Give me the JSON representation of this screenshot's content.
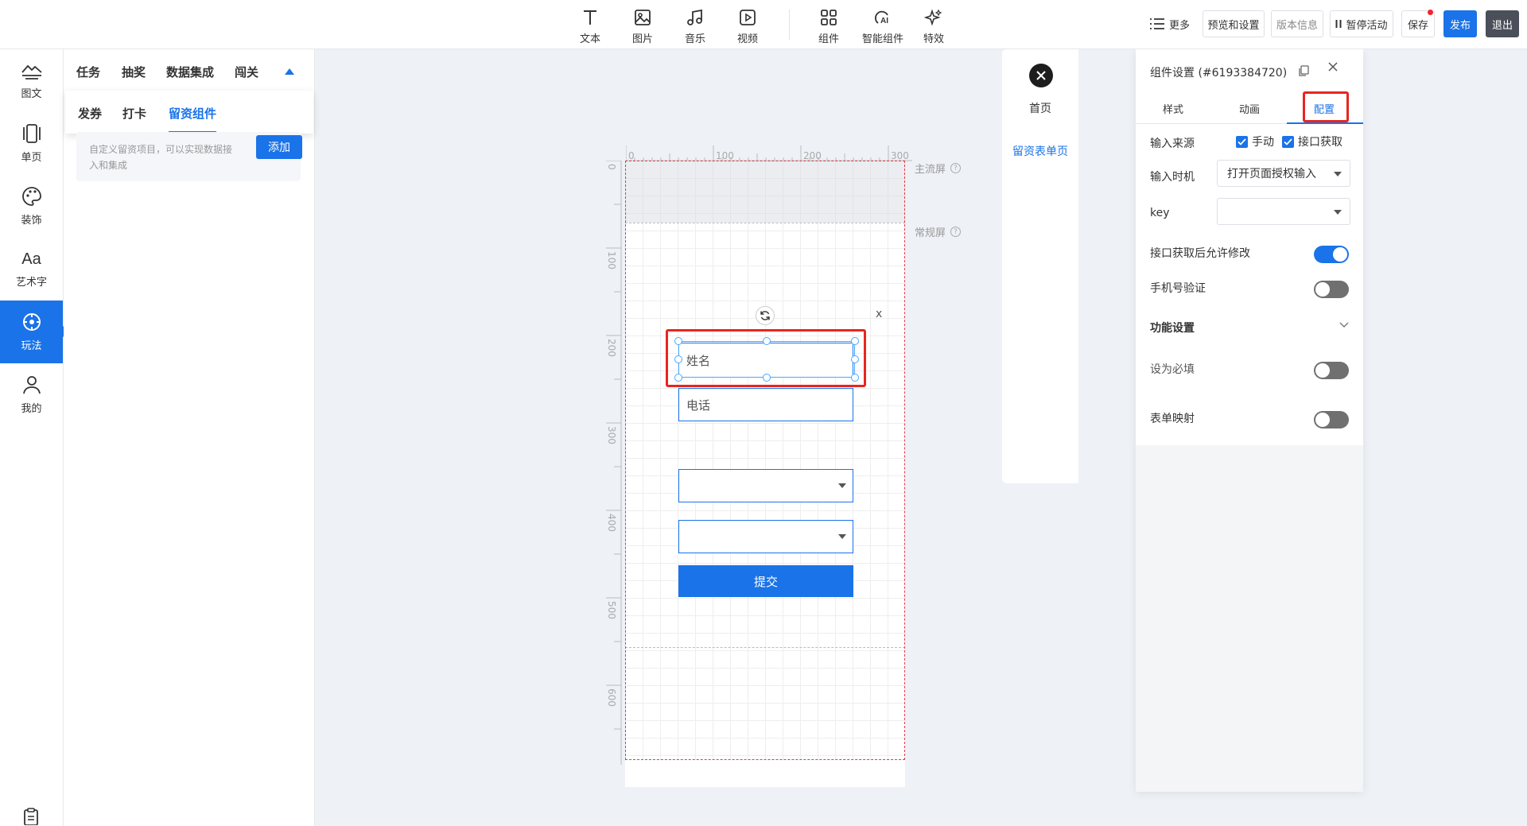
{
  "toolbar": {
    "tools": [
      {
        "label": "文本",
        "icon": "text-icon"
      },
      {
        "label": "图片",
        "icon": "image-icon"
      },
      {
        "label": "音乐",
        "icon": "music-icon"
      },
      {
        "label": "视频",
        "icon": "video-icon"
      },
      {
        "label": "组件",
        "icon": "components-icon"
      },
      {
        "label": "智能组件",
        "icon": "ai-icon"
      },
      {
        "label": "特效",
        "icon": "sparkle-icon"
      }
    ],
    "more_label": "更多",
    "preview_label": "预览和设置",
    "version_label": "版本信息",
    "pause_label": "暂停活动",
    "save_label": "保存",
    "publish_label": "发布",
    "exit_label": "退出"
  },
  "left_nav": {
    "items": [
      {
        "label": "图文",
        "icon": "mountain-text-icon"
      },
      {
        "label": "单页",
        "icon": "page-icon"
      },
      {
        "label": "装饰",
        "icon": "palette-icon"
      },
      {
        "label": "艺术字",
        "icon": "art-text-icon"
      },
      {
        "label": "玩法",
        "icon": "gameplay-icon",
        "active": true
      },
      {
        "label": "我的",
        "icon": "user-icon"
      }
    ]
  },
  "component_panel": {
    "top_tabs": [
      "任务",
      "抽奖",
      "数据集成",
      "闯关"
    ],
    "sub_tabs": [
      "发券",
      "打卡",
      "留资组件"
    ],
    "active_sub_tab": "留资组件",
    "card": {
      "description": "自定义留资项目，可以实现数据接入和集成",
      "add_label": "添加"
    }
  },
  "canvas": {
    "ruler_h": [
      "0",
      "100",
      "200",
      "300"
    ],
    "ruler_v": [
      "0",
      "100",
      "200",
      "300",
      "400",
      "500",
      "600"
    ],
    "first_screen_label": "主流屏",
    "regular_screen_label": "常规屏",
    "close_mark": "x",
    "fields": [
      {
        "placeholder": "姓名"
      },
      {
        "placeholder": "电话"
      },
      {
        "placeholder": ""
      },
      {
        "placeholder": ""
      }
    ],
    "submit_label": "提交"
  },
  "page_panel": {
    "home_label": "首页",
    "leads_page_label": "留资表单页"
  },
  "settings": {
    "title": "组件设置 (#6193384720)",
    "tabs": [
      "样式",
      "动画",
      "配置"
    ],
    "active_tab": "配置",
    "input_source_label": "输入来源",
    "manual_label": "手动",
    "api_label": "接口获取",
    "input_timing_label": "输入时机",
    "input_timing_value": "打开页面授权输入",
    "key_label": "key",
    "key_value": "",
    "allow_edit_label": "接口获取后允许修改",
    "allow_edit": true,
    "phone_verify_label": "手机号验证",
    "phone_verify": false,
    "function_section_label": "功能设置",
    "required_label": "设为必填",
    "required": false,
    "form_mapping_label": "表单映射",
    "form_mapping": false
  },
  "colors": {
    "accent": "#1a73e8",
    "highlight_red": "#e8251f"
  }
}
